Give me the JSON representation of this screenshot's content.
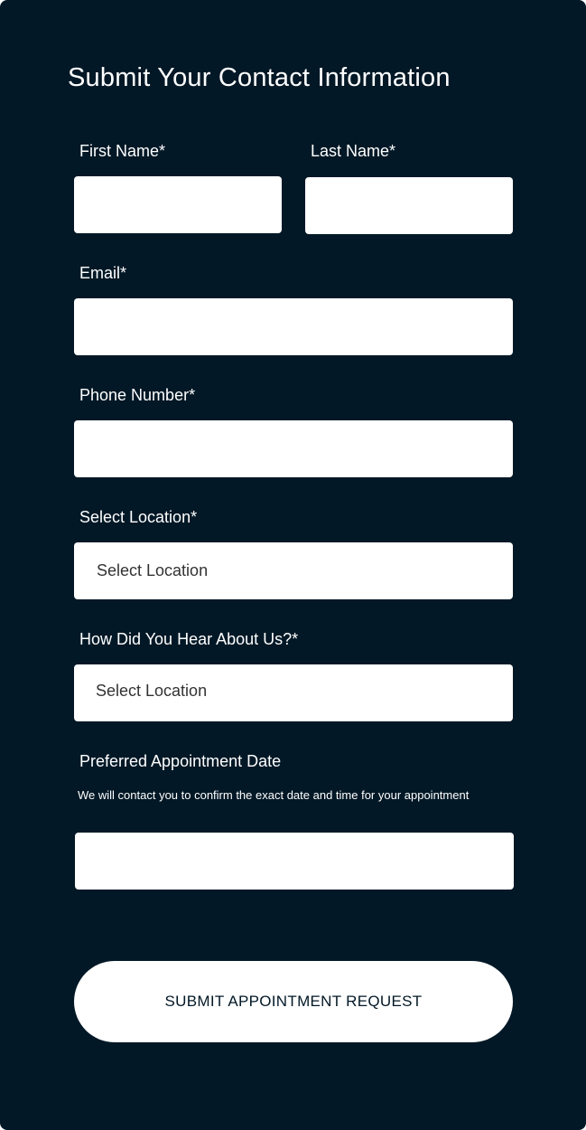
{
  "form": {
    "title": "Submit Your Contact Information",
    "first_name": {
      "label": "First Name*",
      "value": ""
    },
    "last_name": {
      "label": "Last Name*",
      "value": ""
    },
    "email": {
      "label": "Email*",
      "value": ""
    },
    "phone": {
      "label": "Phone Number*",
      "value": ""
    },
    "location": {
      "label": "Select Location*",
      "selected": "Select Location"
    },
    "referral": {
      "label": "How Did You Hear About Us?*",
      "selected": "Select Location"
    },
    "appointment_date": {
      "label": "Preferred Appointment Date",
      "helper": "We will contact you to confirm the exact date and time for your appointment",
      "value": ""
    },
    "submit_label": "SUBMIT APPOINTMENT REQUEST"
  },
  "colors": {
    "background": "#021826",
    "field": "#ffffff",
    "text_light": "#ffffff",
    "text_dark": "#333333"
  }
}
